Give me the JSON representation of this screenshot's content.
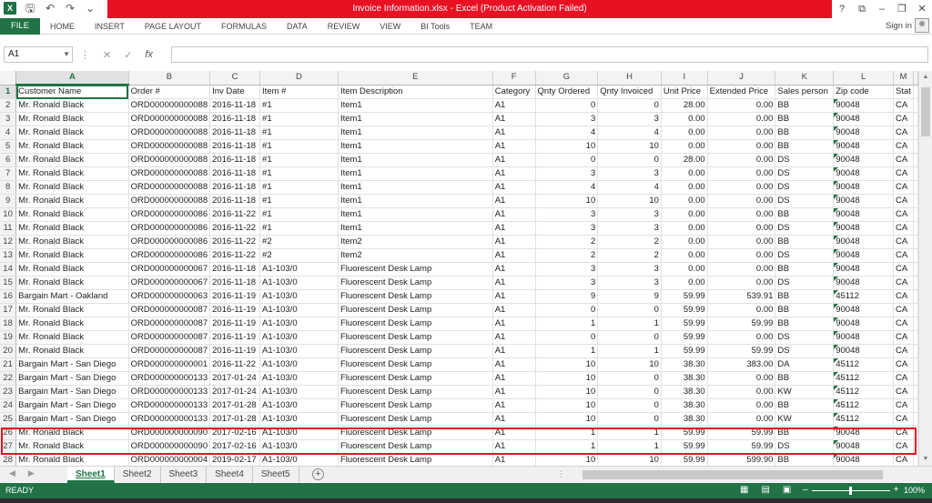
{
  "window": {
    "title": "Invoice Information.xlsx - Excel (Product Activation Failed)",
    "controls": [
      "?",
      "⧉",
      "–",
      "❐",
      "✕"
    ]
  },
  "ribbon": {
    "file_label": "FILE",
    "tabs": [
      "HOME",
      "INSERT",
      "PAGE LAYOUT",
      "FORMULAS",
      "DATA",
      "REVIEW",
      "VIEW",
      "BI Tools",
      "TEAM"
    ],
    "sign_in": "Sign in"
  },
  "formula_bar": {
    "name_box": "A1",
    "fx": "fx",
    "value": ""
  },
  "grid": {
    "column_letters": [
      "A",
      "B",
      "C",
      "D",
      "E",
      "F",
      "G",
      "H",
      "I",
      "J",
      "K",
      "L",
      "M"
    ],
    "headers": [
      "Customer Name",
      "Order #",
      "Inv Date",
      "Item #",
      "Item Description",
      "Category",
      "Qnty Ordered",
      "Qnty Invoiced",
      "Unit Price",
      "Extended Price",
      "Sales person",
      "Zip code",
      "Stat"
    ],
    "rows": [
      [
        "Mr. Ronald Black",
        "ORD000000000088",
        "2016-11-18",
        "#1",
        "Item1",
        "A1",
        "0",
        "0",
        "28.00",
        "0.00",
        "BB",
        "90048",
        "CA"
      ],
      [
        "Mr. Ronald Black",
        "ORD000000000088",
        "2016-11-18",
        "#1",
        "Item1",
        "A1",
        "3",
        "3",
        "0.00",
        "0.00",
        "BB",
        "90048",
        "CA"
      ],
      [
        "Mr. Ronald Black",
        "ORD000000000088",
        "2016-11-18",
        "#1",
        "Item1",
        "A1",
        "4",
        "4",
        "0.00",
        "0.00",
        "BB",
        "90048",
        "CA"
      ],
      [
        "Mr. Ronald Black",
        "ORD000000000088",
        "2016-11-18",
        "#1",
        "Item1",
        "A1",
        "10",
        "10",
        "0.00",
        "0.00",
        "BB",
        "90048",
        "CA"
      ],
      [
        "Mr. Ronald Black",
        "ORD000000000088",
        "2016-11-18",
        "#1",
        "Item1",
        "A1",
        "0",
        "0",
        "28.00",
        "0.00",
        "DS",
        "90048",
        "CA"
      ],
      [
        "Mr. Ronald Black",
        "ORD000000000088",
        "2016-11-18",
        "#1",
        "Item1",
        "A1",
        "3",
        "3",
        "0.00",
        "0.00",
        "DS",
        "90048",
        "CA"
      ],
      [
        "Mr. Ronald Black",
        "ORD000000000088",
        "2016-11-18",
        "#1",
        "Item1",
        "A1",
        "4",
        "4",
        "0.00",
        "0.00",
        "DS",
        "90048",
        "CA"
      ],
      [
        "Mr. Ronald Black",
        "ORD000000000088",
        "2016-11-18",
        "#1",
        "Item1",
        "A1",
        "10",
        "10",
        "0.00",
        "0.00",
        "DS",
        "90048",
        "CA"
      ],
      [
        "Mr. Ronald Black",
        "ORD000000000086",
        "2016-11-22",
        "#1",
        "Item1",
        "A1",
        "3",
        "3",
        "0.00",
        "0.00",
        "BB",
        "90048",
        "CA"
      ],
      [
        "Mr. Ronald Black",
        "ORD000000000086",
        "2016-11-22",
        "#1",
        "Item1",
        "A1",
        "3",
        "3",
        "0.00",
        "0.00",
        "DS",
        "90048",
        "CA"
      ],
      [
        "Mr. Ronald Black",
        "ORD000000000086",
        "2016-11-22",
        "#2",
        "Item2",
        "A1",
        "2",
        "2",
        "0.00",
        "0.00",
        "BB",
        "90048",
        "CA"
      ],
      [
        "Mr. Ronald Black",
        "ORD000000000086",
        "2016-11-22",
        "#2",
        "Item2",
        "A1",
        "2",
        "2",
        "0.00",
        "0.00",
        "DS",
        "90048",
        "CA"
      ],
      [
        "Mr. Ronald Black",
        "ORD000000000067",
        "2016-11-18",
        "A1-103/0",
        "Fluorescent Desk Lamp",
        "A1",
        "3",
        "3",
        "0.00",
        "0.00",
        "BB",
        "90048",
        "CA"
      ],
      [
        "Mr. Ronald Black",
        "ORD000000000067",
        "2016-11-18",
        "A1-103/0",
        "Fluorescent Desk Lamp",
        "A1",
        "3",
        "3",
        "0.00",
        "0.00",
        "DS",
        "90048",
        "CA"
      ],
      [
        "Bargain Mart - Oakland",
        "ORD000000000063",
        "2016-11-19",
        "A1-103/0",
        "Fluorescent Desk Lamp",
        "A1",
        "9",
        "9",
        "59.99",
        "539.91",
        "BB",
        "45112",
        "CA"
      ],
      [
        "Mr. Ronald Black",
        "ORD000000000087",
        "2016-11-19",
        "A1-103/0",
        "Fluorescent Desk Lamp",
        "A1",
        "0",
        "0",
        "59.99",
        "0.00",
        "BB",
        "90048",
        "CA"
      ],
      [
        "Mr. Ronald Black",
        "ORD000000000087",
        "2016-11-19",
        "A1-103/0",
        "Fluorescent Desk Lamp",
        "A1",
        "1",
        "1",
        "59.99",
        "59.99",
        "BB",
        "90048",
        "CA"
      ],
      [
        "Mr. Ronald Black",
        "ORD000000000087",
        "2016-11-19",
        "A1-103/0",
        "Fluorescent Desk Lamp",
        "A1",
        "0",
        "0",
        "59.99",
        "0.00",
        "DS",
        "90048",
        "CA"
      ],
      [
        "Mr. Ronald Black",
        "ORD000000000087",
        "2016-11-19",
        "A1-103/0",
        "Fluorescent Desk Lamp",
        "A1",
        "1",
        "1",
        "59.99",
        "59.99",
        "DS",
        "90048",
        "CA"
      ],
      [
        "Bargain Mart - San Diego",
        "ORD000000000001",
        "2016-11-22",
        "A1-103/0",
        "Fluorescent Desk Lamp",
        "A1",
        "10",
        "10",
        "38.30",
        "383.00",
        "DA",
        "45112",
        "CA"
      ],
      [
        "Bargain Mart - San Diego",
        "ORD000000000133",
        "2017-01-24",
        "A1-103/0",
        "Fluorescent Desk Lamp",
        "A1",
        "10",
        "0",
        "38.30",
        "0.00",
        "BB",
        "45112",
        "CA"
      ],
      [
        "Bargain Mart - San Diego",
        "ORD000000000133",
        "2017-01-24",
        "A1-103/0",
        "Fluorescent Desk Lamp",
        "A1",
        "10",
        "0",
        "38.30",
        "0.00",
        "KW",
        "45112",
        "CA"
      ],
      [
        "Bargain Mart - San Diego",
        "ORD000000000133",
        "2017-01-28",
        "A1-103/0",
        "Fluorescent Desk Lamp",
        "A1",
        "10",
        "0",
        "38.30",
        "0.00",
        "BB",
        "45112",
        "CA"
      ],
      [
        "Bargain Mart - San Diego",
        "ORD000000000133",
        "2017-01-28",
        "A1-103/0",
        "Fluorescent Desk Lamp",
        "A1",
        "10",
        "0",
        "38.30",
        "0.00",
        "KW",
        "45112",
        "CA"
      ],
      [
        "Mr. Ronald Black",
        "ORD000000000090",
        "2017-02-16",
        "A1-103/0",
        "Fluorescent Desk Lamp",
        "A1",
        "1",
        "1",
        "59.99",
        "59.99",
        "BB",
        "90048",
        "CA"
      ],
      [
        "Mr. Ronald Black",
        "ORD000000000090",
        "2017-02-16",
        "A1-103/0",
        "Fluorescent Desk Lamp",
        "A1",
        "1",
        "1",
        "59.99",
        "59.99",
        "DS",
        "90048",
        "CA"
      ],
      [
        "Mr. Ronald Black",
        "ORD000000000004",
        "2019-02-17",
        "A1-103/0",
        "Fluorescent Desk Lamp",
        "A1",
        "10",
        "10",
        "59.99",
        "599.90",
        "BB",
        "90048",
        "CA"
      ]
    ]
  },
  "sheets": [
    "Sheet1",
    "Sheet2",
    "Sheet3",
    "Sheet4",
    "Sheet5"
  ],
  "status": {
    "ready": "READY",
    "zoom": "100%"
  },
  "colors": {
    "accent": "#217346",
    "title_warning": "#e81123"
  }
}
